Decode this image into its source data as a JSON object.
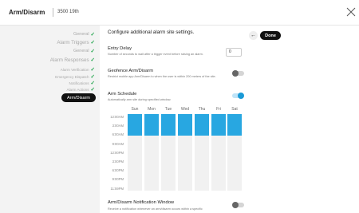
{
  "header": {
    "title": "Arm/Disarm",
    "subtitle": "3500 19th"
  },
  "sidebar": {
    "items": [
      {
        "label": "General",
        "checked": true
      },
      {
        "label": "Alarm Triggers",
        "checked": true
      },
      {
        "label": "General",
        "checked": true
      },
      {
        "label": "Alarm Responses",
        "checked": true
      },
      {
        "label": "Alarm Verification",
        "checked": true
      },
      {
        "label": "Emergency Dispatch",
        "checked": true
      },
      {
        "label": "Notifications",
        "checked": true
      },
      {
        "label": "Alarm Actions",
        "checked": true
      }
    ],
    "active": "Arm/Disarm"
  },
  "main": {
    "intro": "Configure additional alarm site settings.",
    "back_icon": "←",
    "done_label": "Done",
    "entry_delay": {
      "label": "Entry Delay",
      "desc": "Number of seconds to wait after a trigger event before raising an alarm.",
      "value": "0"
    },
    "geofence": {
      "label": "Geofence Arm/Disarm",
      "desc": "Restrict mobile app Arm/Disarm to when the user is within 200 meters of the site.",
      "enabled": false
    },
    "arm_schedule": {
      "label": "Arm Schedule",
      "desc": "Automatically arm site during specified window.",
      "enabled": true
    },
    "schedule": {
      "days": [
        "Sun",
        "Mon",
        "Tue",
        "Wed",
        "Thu",
        "Fri",
        "Sat"
      ],
      "times": [
        "12:00AM",
        "3:00AM",
        "6:00AM",
        "9:00AM",
        "12:00PM",
        "3:00PM",
        "6:00PM",
        "9:00PM",
        "11:59PM"
      ],
      "armed_window": [
        "12:00AM",
        "6:00AM"
      ]
    },
    "notification": {
      "label": "Arm/Disarm Notification Window",
      "desc": "Receive a notification whenever an arm/disarm occurs within a specific",
      "enabled": false
    }
  },
  "colors": {
    "accent": "#28a7e1",
    "check": "#1ea34a",
    "dark": "#111111"
  }
}
